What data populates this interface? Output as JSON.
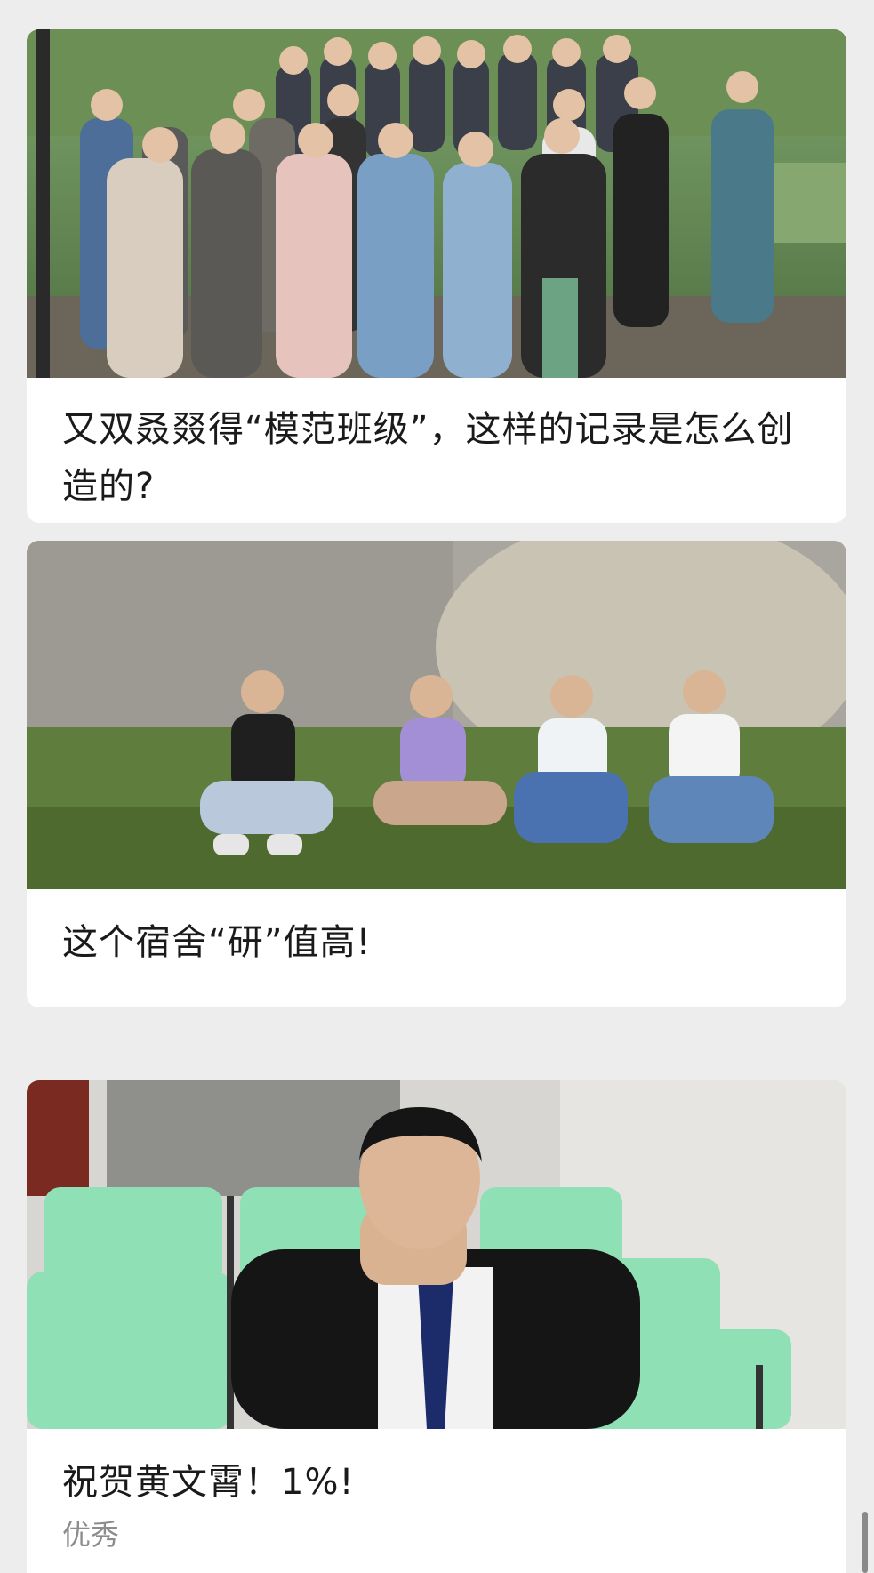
{
  "feed": {
    "cards": [
      {
        "title": "又双叒叕得“模范班级”，这样的记录是怎么创造的?",
        "image_subject": "class-group-photo"
      },
      {
        "title": "这个宿舍“研”值高!",
        "image_subject": "four-students-on-grass"
      },
      {
        "title": "祝贺黄文霄！1%!",
        "subtitle": "优秀",
        "image_subject": "student-portrait-green-seats"
      }
    ]
  },
  "colors": {
    "page_background": "#ededed",
    "card_background": "#ffffff",
    "title_text": "#1a1a1a",
    "subtitle_text": "#8c8c8c"
  },
  "scrollbar": {
    "position": "near-bottom"
  }
}
